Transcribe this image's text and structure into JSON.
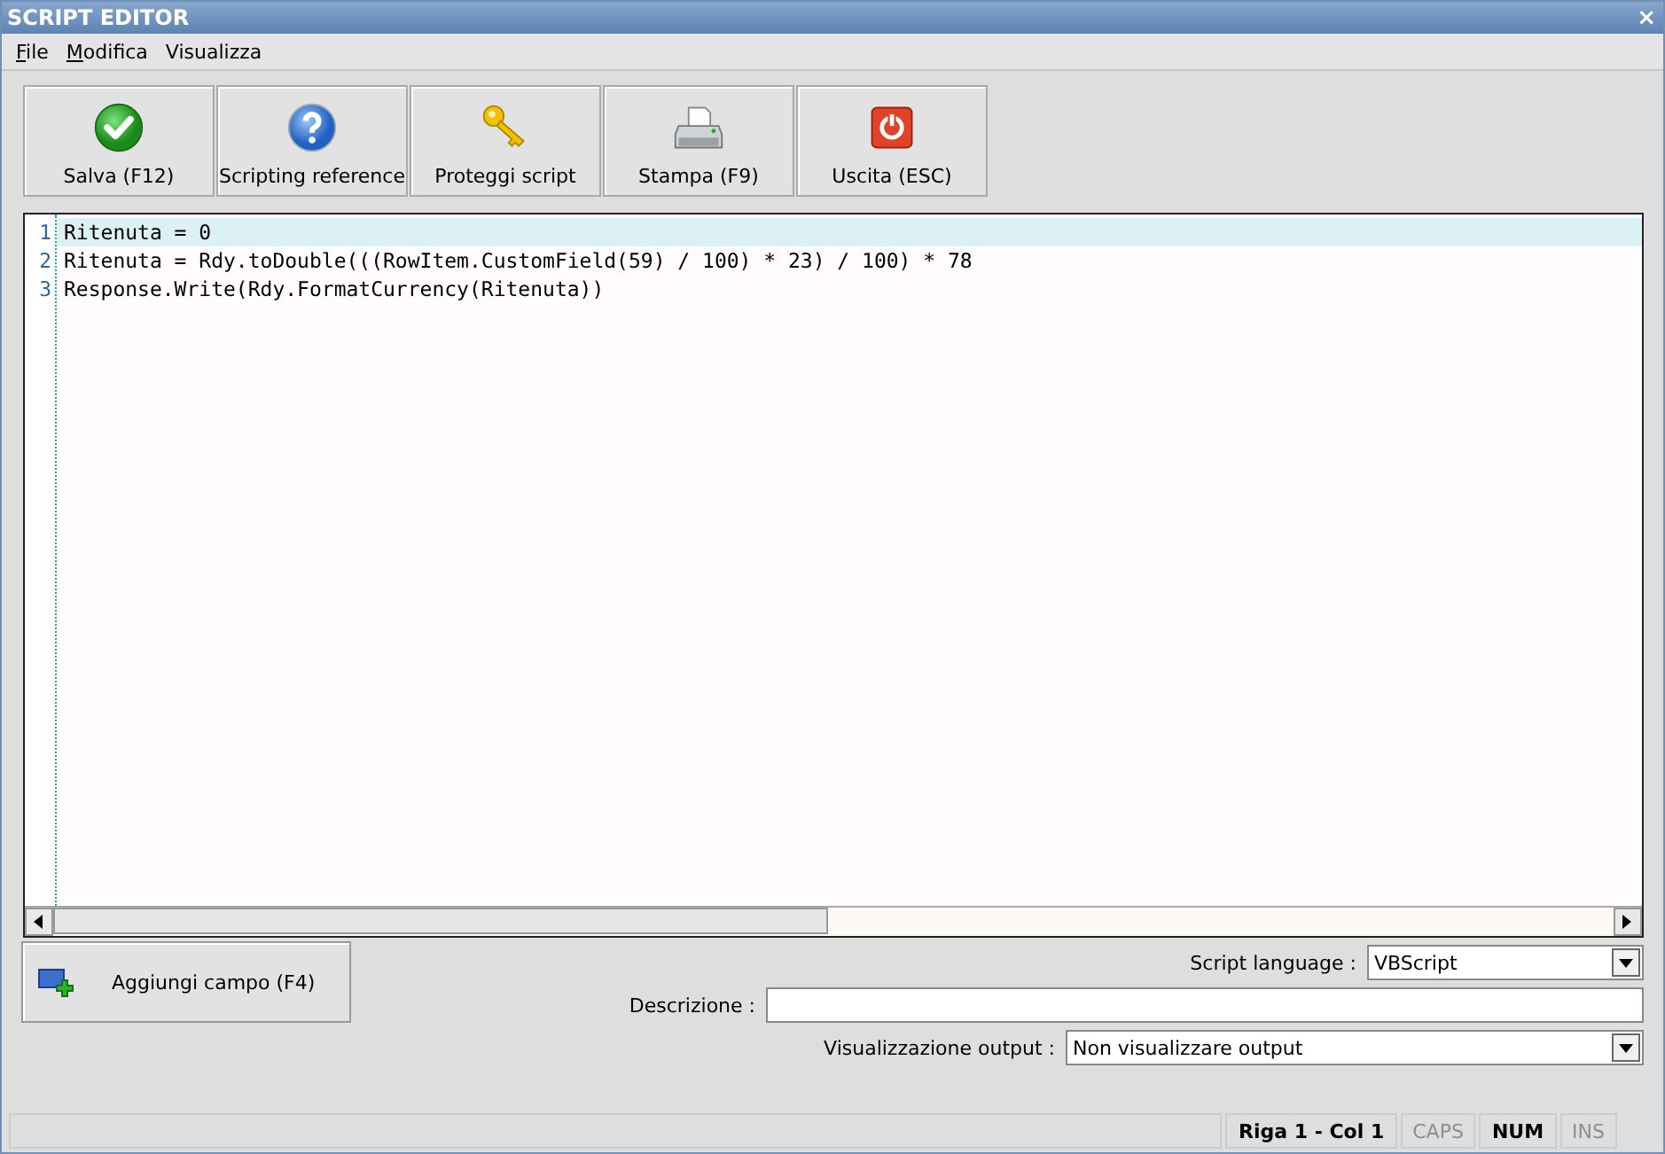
{
  "window": {
    "title": "SCRIPT EDITOR",
    "close": "×"
  },
  "menu": [
    {
      "label": "File",
      "underline_first": true
    },
    {
      "label": "Modifica",
      "underline_first": true
    },
    {
      "label": "Visualizza",
      "underline_first": false
    }
  ],
  "toolbar": [
    {
      "label": "Salva (F12)",
      "kind": "check"
    },
    {
      "label": "Scripting reference",
      "kind": "help"
    },
    {
      "label": "Proteggi script",
      "kind": "key"
    },
    {
      "label": "Stampa (F9)",
      "kind": "printer"
    },
    {
      "label": "Uscita (ESC)",
      "kind": "power"
    }
  ],
  "editor": {
    "lines": [
      {
        "number": "1",
        "text": "Ritenuta = 0",
        "current": true
      },
      {
        "number": "2",
        "text": "Ritenuta = Rdy.toDouble(((RowItem.CustomField(59) / 100) * 23) / 100) * 78",
        "current": false
      },
      {
        "number": "3",
        "text": "Response.Write(Rdy.FormatCurrency(Ritenuta))",
        "current": false
      }
    ]
  },
  "add_field_button": {
    "label": "Aggiungi campo (F4)"
  },
  "form": [
    {
      "label": "Script language :",
      "kind": "dropdown",
      "value": "VBScript"
    },
    {
      "label": "Descrizione :",
      "kind": "text"
    },
    {
      "label": "Visualizzazione output :",
      "kind": "dropdown",
      "value": "Non visualizzare output"
    }
  ],
  "status_bar": [
    {
      "text": "Riga 1 - Col 1",
      "enabled": true
    },
    {
      "text": "CAPS",
      "enabled": false
    },
    {
      "text": "NUM",
      "enabled": true
    },
    {
      "text": "INS",
      "enabled": false
    }
  ]
}
